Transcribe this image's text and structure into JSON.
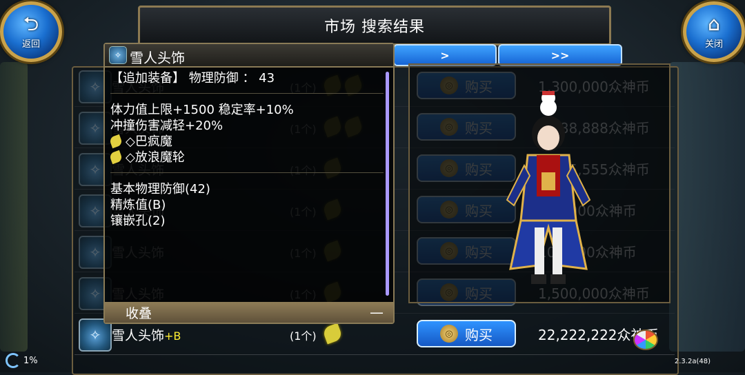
{
  "header": {
    "title": "市场  搜索结果",
    "back_label": "返回",
    "close_label": "关闭"
  },
  "nav": {
    "prev": "<",
    "next": ">",
    "last": ">>"
  },
  "tooltip": {
    "item_name": "雪人头饰",
    "equip_line": "【追加装备】  物理防御 ：  43",
    "stats": [
      "体力值上限+1500 稳定率+10%",
      "冲撞伤害减轻+20%"
    ],
    "gems": [
      "◇巴疯魔",
      "◇放浪魔轮"
    ],
    "base": [
      "基本物理防御(42)",
      "精炼值(B)",
      "镶嵌孔(2)"
    ],
    "collapse_label": "收叠",
    "collapse_symbol": "—"
  },
  "rows": [
    {
      "name": "雪人头饰",
      "plus": "",
      "qty": "(1个)",
      "buy": "购买",
      "price": "1,300,000众神币",
      "faded": true,
      "gems": 2
    },
    {
      "name": "雪人头饰",
      "plus": "",
      "qty": "(1个)",
      "buy": "购买",
      "price": "8,888,888众神币",
      "faded": true,
      "gems": 2
    },
    {
      "name": "雪人头饰",
      "plus": "",
      "qty": "(1个)",
      "buy": "购买",
      "price": "5,555,555众神币",
      "faded": true,
      "gems": 1
    },
    {
      "name": "雪人头饰",
      "plus": "",
      "qty": "(1个)",
      "buy": "购买",
      "price": "100,000众神币",
      "faded": true,
      "gems": 1
    },
    {
      "name": "雪人头饰",
      "plus": "",
      "qty": "(1个)",
      "buy": "购买",
      "price": "100,000众神币",
      "faded": true,
      "gems": 1
    },
    {
      "name": "雪人头饰",
      "plus": "",
      "qty": "(1个)",
      "buy": "购买",
      "price": "1,500,000众神币",
      "faded": true,
      "gems": 1
    },
    {
      "name": "雪人头饰",
      "plus": "+B",
      "qty": "(1个)",
      "buy": "购买",
      "price": "22,222,222众神币",
      "faded": false,
      "gems": 1
    }
  ],
  "status": {
    "percent": "1%",
    "version": "2.3.2a(48)"
  },
  "colors": {
    "accent_blue": "#1664d4",
    "gold_frame": "#c9a24a",
    "gem_yellow": "#d8cc3a",
    "plus_yellow": "#ffee33"
  }
}
